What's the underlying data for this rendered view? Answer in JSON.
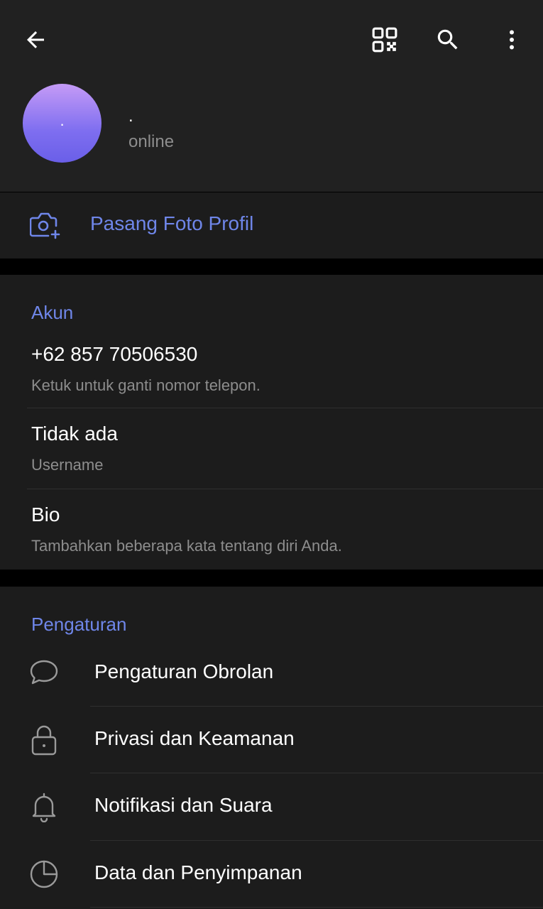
{
  "topbar": {
    "back_icon": "arrow-left-icon",
    "qr_icon": "qr-code-icon",
    "search_icon": "search-icon",
    "more_icon": "more-vertical-icon"
  },
  "profile": {
    "avatar_initial": ".",
    "name": ".",
    "status": "online",
    "avatar_gradient": [
      "#c59bf6",
      "#6a5fe8"
    ]
  },
  "set_photo": {
    "label": "Pasang Foto Profil",
    "icon": "camera-add-icon"
  },
  "account": {
    "title": "Akun",
    "phone": "+62 857 70506530",
    "phone_hint": "Ketuk untuk ganti nomor telepon.",
    "username": "Tidak ada",
    "username_label": "Username",
    "bio": "Bio",
    "bio_hint": "Tambahkan beberapa kata tentang diri Anda."
  },
  "settings": {
    "title": "Pengaturan",
    "items": [
      {
        "label": "Pengaturan Obrolan",
        "icon": "chat-bubble-icon"
      },
      {
        "label": "Privasi dan Keamanan",
        "icon": "lock-icon"
      },
      {
        "label": "Notifikasi dan Suara",
        "icon": "bell-icon"
      },
      {
        "label": "Data dan Penyimpanan",
        "icon": "clock-pie-icon"
      }
    ]
  },
  "colors": {
    "accent": "#6f86e9",
    "background": "#1c1c1c",
    "header": "#212121",
    "secondary_text": "#8d8d8d"
  }
}
